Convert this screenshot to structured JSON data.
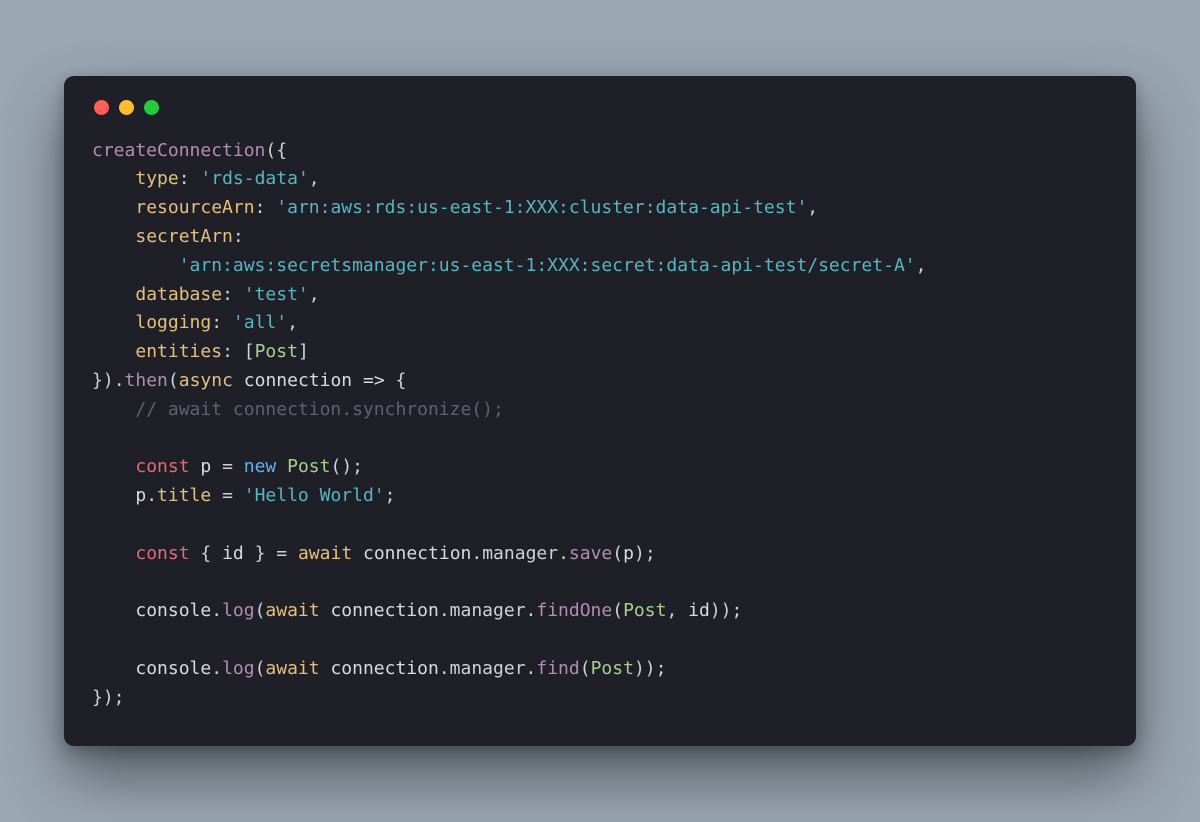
{
  "trafficLights": [
    "red",
    "yellow",
    "green"
  ],
  "code": {
    "createConnection": "createConnection",
    "type_key": "type",
    "type_val": "'rds-data'",
    "resourceArn_key": "resourceArn",
    "resourceArn_val": "'arn:aws:rds:us-east-1:XXX:cluster:data-api-test'",
    "secretArn_key": "secretArn",
    "secretArn_val": "'arn:aws:secretsmanager:us-east-1:XXX:secret:data-api-test/secret-A'",
    "database_key": "database",
    "database_val": "'test'",
    "logging_key": "logging",
    "logging_val": "'all'",
    "entities_key": "entities",
    "entities_val": "Post",
    "then": "then",
    "async": "async",
    "connection_param": "connection",
    "comment": "// await connection.synchronize();",
    "const": "const",
    "p_var": "p",
    "new": "new",
    "Post_class": "Post",
    "title_prop": "title",
    "hello_str": "'Hello World'",
    "id_var": "id",
    "await": "await",
    "connection": "connection",
    "manager": "manager",
    "save": "save",
    "console": "console",
    "log": "log",
    "findOne": "findOne",
    "find": "find",
    "eq": " = ",
    "dot": ".",
    "comma": ",",
    "semi": ";",
    "colon_sp": ": ",
    "colon": ":",
    "openParen": "(",
    "closeParen": ")",
    "openBrace": "{",
    "closeBrace": "}",
    "openBracket": "[",
    "closeBracket": "]",
    "arrow": " => ",
    "closeBraceParen": "})",
    "closeParenParenSemi": "));",
    "closeBraceParenSemi": "});",
    "indent1": "    ",
    "indent2": "        ",
    "p_arg": "p",
    "comma_sp": ", "
  }
}
